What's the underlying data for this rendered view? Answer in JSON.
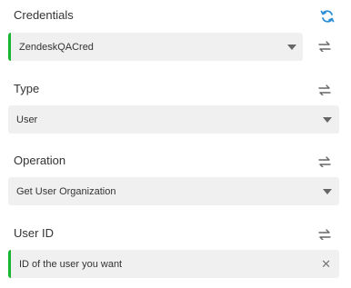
{
  "credentials": {
    "label": "Credentials",
    "value": "ZendeskQACred"
  },
  "type": {
    "label": "Type",
    "value": "User"
  },
  "operation": {
    "label": "Operation",
    "value": "Get User Organization"
  },
  "user_id": {
    "label": "User ID",
    "value": "ID of the user you want"
  },
  "colors": {
    "accent_green": "#19b531",
    "refresh_blue": "#2a8fd6",
    "field_bg": "#f0f0f0"
  },
  "icons": {
    "refresh": "refresh-icon",
    "swap": "swap-arrows-icon",
    "dropdown": "chevron-down-icon",
    "clear": "close-icon"
  }
}
